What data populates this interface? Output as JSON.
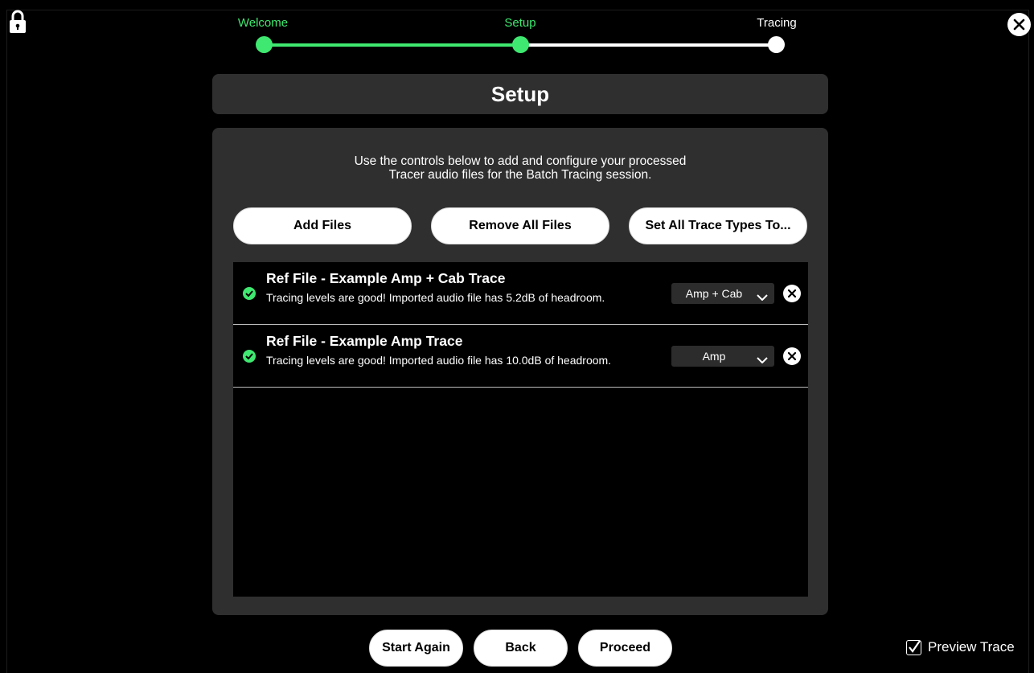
{
  "stepper": {
    "steps": [
      {
        "label": "Welcome",
        "state": "done"
      },
      {
        "label": "Setup",
        "state": "current"
      },
      {
        "label": "Tracing",
        "state": "todo"
      }
    ]
  },
  "page": {
    "title": "Setup",
    "instructions_line1": "Use the controls below to add and configure your processed",
    "instructions_line2": "Tracer audio files for the Batch Tracing session."
  },
  "toolbar": {
    "add_files": "Add Files",
    "remove_all": "Remove All Files",
    "set_all_types": "Set All Trace Types To..."
  },
  "files": [
    {
      "name": "Ref File - Example Amp + Cab Trace",
      "status": "Tracing levels are good!  Imported audio file has 5.2dB of headroom.",
      "trace_type": "Amp + Cab"
    },
    {
      "name": "Ref File - Example Amp Trace",
      "status": "Tracing levels are good!  Imported audio file has 10.0dB of headroom.",
      "trace_type": "Amp"
    }
  ],
  "footer": {
    "start_again": "Start Again",
    "back": "Back",
    "proceed": "Proceed",
    "preview_trace": "Preview Trace",
    "preview_checked": true
  },
  "colors": {
    "accent": "#3fe870",
    "panel": "#2f2f2f",
    "background": "#000000"
  },
  "icons": [
    "lock-icon",
    "close-icon",
    "check-circle-icon",
    "chevron-down-icon",
    "remove-icon",
    "checkbox-icon"
  ]
}
